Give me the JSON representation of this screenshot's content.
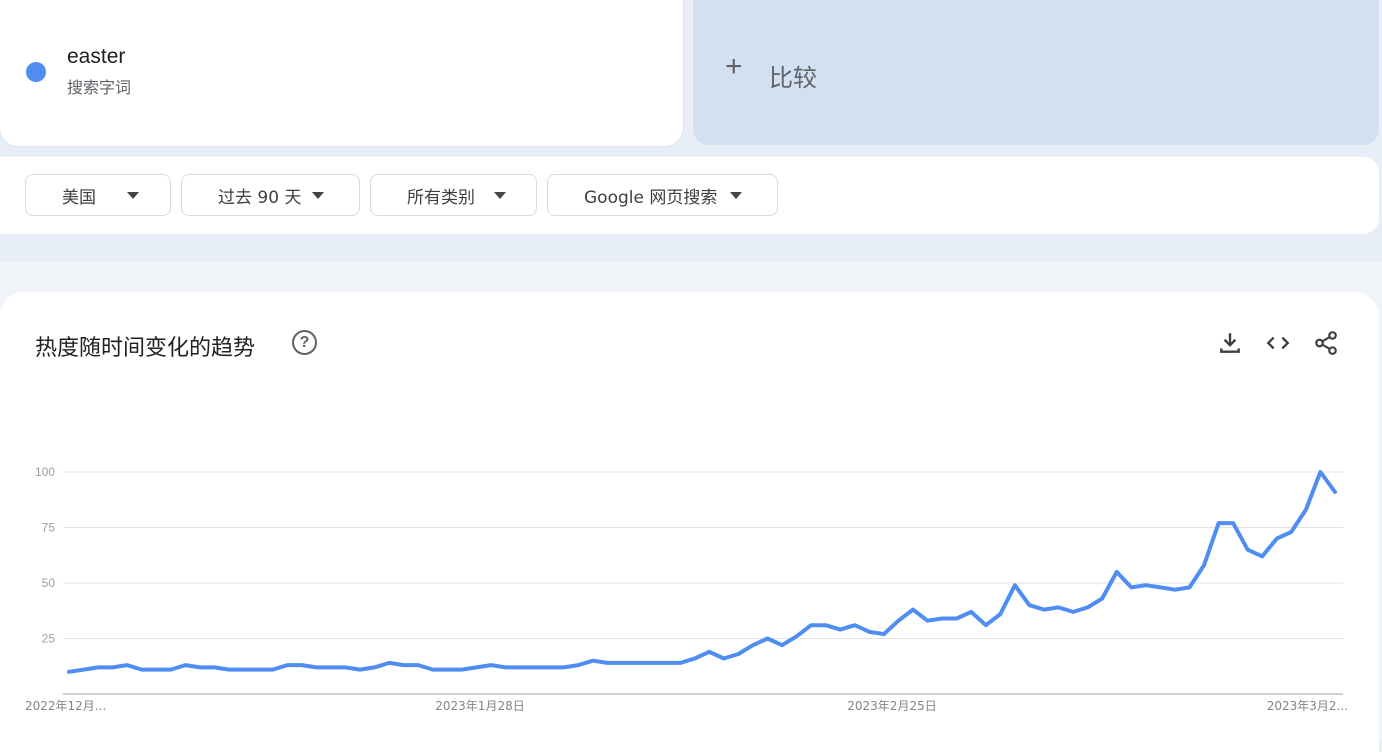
{
  "term": {
    "name": "easter",
    "type_label": "搜索字词",
    "color": "#4f8df3"
  },
  "compare": {
    "plus": "+",
    "label": "比较"
  },
  "filters": [
    {
      "label": "美国"
    },
    {
      "label": "过去 90 天"
    },
    {
      "label": "所有类别"
    },
    {
      "label": "Google 网页搜索"
    }
  ],
  "chart_section": {
    "title": "热度随时间变化的趋势",
    "help_icon": "help-circle-icon",
    "tools": [
      "download-icon",
      "embed-code-icon",
      "share-icon"
    ]
  },
  "chart_data": {
    "type": "line",
    "title": "",
    "xlabel": "",
    "ylabel": "",
    "ylim": [
      0,
      100
    ],
    "y_ticks": [
      25,
      50,
      75,
      100
    ],
    "x_tick_labels": [
      "2022年12月...",
      "2023年1月28日",
      "2023年2月25日",
      "2023年3月2..."
    ],
    "grid": true,
    "series": [
      {
        "name": "easter",
        "color": "#4f8df3",
        "values": [
          10,
          11,
          12,
          12,
          13,
          11,
          11,
          11,
          13,
          12,
          12,
          11,
          11,
          11,
          11,
          13,
          13,
          12,
          12,
          12,
          11,
          12,
          14,
          13,
          13,
          11,
          11,
          11,
          12,
          13,
          12,
          12,
          12,
          12,
          12,
          13,
          15,
          14,
          14,
          14,
          14,
          14,
          14,
          16,
          19,
          16,
          18,
          22,
          25,
          22,
          26,
          31,
          31,
          29,
          31,
          28,
          27,
          33,
          38,
          33,
          34,
          34,
          37,
          31,
          36,
          49,
          40,
          38,
          39,
          37,
          39,
          43,
          55,
          48,
          49,
          48,
          47,
          48,
          58,
          77,
          77,
          65,
          62,
          70,
          73,
          83,
          100,
          91
        ]
      }
    ]
  }
}
